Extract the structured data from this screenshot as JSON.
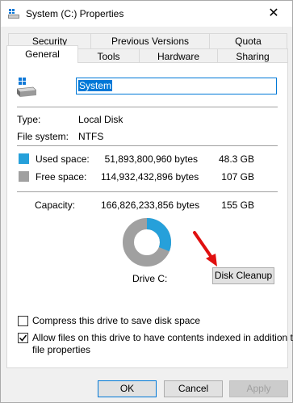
{
  "window": {
    "title": "System (C:) Properties",
    "close_glyph": "✕"
  },
  "tabs": {
    "row1": [
      "Security",
      "Previous Versions",
      "Quota"
    ],
    "row2": [
      "General",
      "Tools",
      "Hardware",
      "Sharing"
    ],
    "active": "General"
  },
  "general": {
    "drive_name": "System",
    "type_label": "Type:",
    "type_value": "Local Disk",
    "fs_label": "File system:",
    "fs_value": "NTFS",
    "used_label": "Used space:",
    "used_bytes": "51,893,800,960 bytes",
    "used_size": "48.3 GB",
    "free_label": "Free space:",
    "free_bytes": "114,932,432,896 bytes",
    "free_size": "107 GB",
    "capacity_label": "Capacity:",
    "capacity_bytes": "166,826,233,856 bytes",
    "capacity_size": "155 GB",
    "drive_label": "Drive C:",
    "used_fraction": 0.311,
    "used_color": "#26a0da",
    "free_color": "#a0a0a0",
    "disk_cleanup_label": "Disk Cleanup",
    "compress_label": "Compress this drive to save disk space",
    "compress_checked": false,
    "index_label_line1": "Allow files on this drive to have contents indexed in addition to",
    "index_label_line2": "file properties",
    "index_checked": true
  },
  "footer": {
    "ok": "OK",
    "cancel": "Cancel",
    "apply": "Apply"
  },
  "icons": [
    "drive-icon",
    "close-icon",
    "arrow-pointer-icon",
    "checkmark-icon"
  ]
}
